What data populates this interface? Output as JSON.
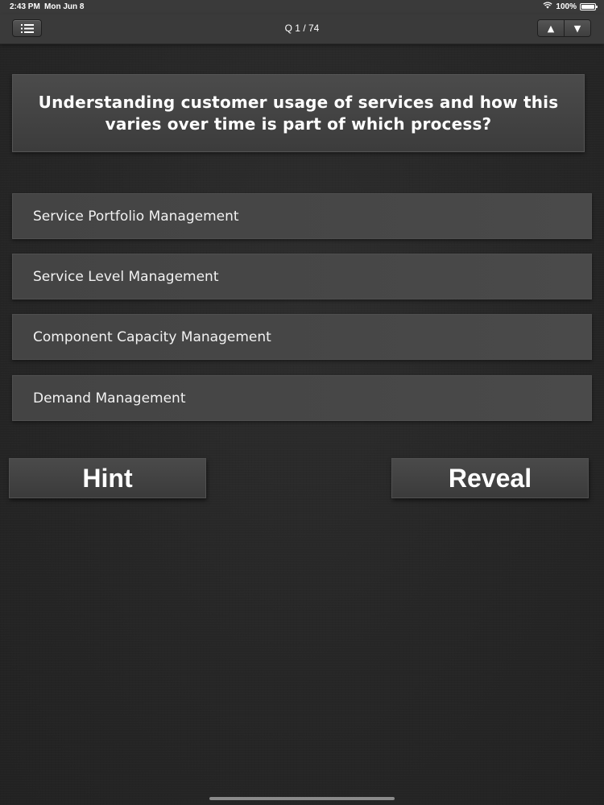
{
  "status_bar": {
    "time": "2:43 PM",
    "date": "Mon Jun 8",
    "battery_percent": "100%",
    "battery_level": 1.0,
    "wifi_icon": "wifi-icon",
    "battery_icon": "battery-icon"
  },
  "nav": {
    "title": "Q 1 / 74",
    "menu_icon": "list-icon",
    "up_icon": "triangle-up-icon",
    "down_icon": "triangle-down-icon",
    "up_glyph": "▲",
    "down_glyph": "▼"
  },
  "question": {
    "text": "Understanding customer usage of services and how this varies over time is part of which process?"
  },
  "answers": [
    {
      "label": "Service Portfolio Management"
    },
    {
      "label": "Service Level Management"
    },
    {
      "label": "Component Capacity Management"
    },
    {
      "label": "Demand Management"
    }
  ],
  "actions": {
    "hint_label": "Hint",
    "reveal_label": "Reveal"
  },
  "colors": {
    "background": "#262626",
    "bar": "#3a3a3a",
    "card": "#444444",
    "text": "#ffffff"
  }
}
